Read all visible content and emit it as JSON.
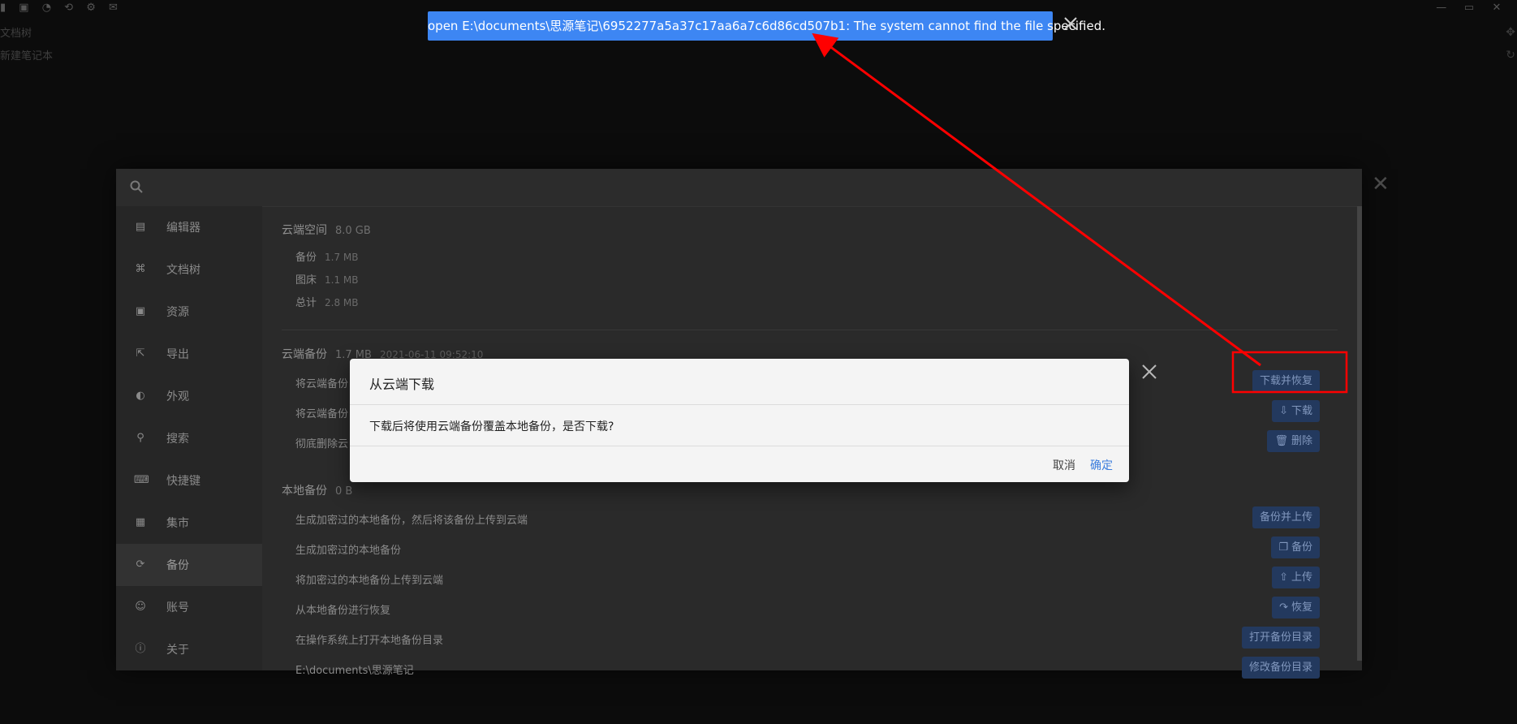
{
  "background": {
    "top_icons": "▮ ▣ ◔ ⟲ ⚙ ✉",
    "line_1": "文档树",
    "line_2": "新建笔记本",
    "window_buttons": [
      "—",
      "▭",
      "✕"
    ]
  },
  "settings": {
    "search_placeholder": "",
    "sidebar": [
      {
        "label": "编辑器",
        "icon": "keyboard-icon",
        "glyph": "▤"
      },
      {
        "label": "文档树",
        "icon": "tree-icon",
        "glyph": "⌘"
      },
      {
        "label": "资源",
        "icon": "image-icon",
        "glyph": "▣"
      },
      {
        "label": "导出",
        "icon": "export-icon",
        "glyph": "⇱"
      },
      {
        "label": "外观",
        "icon": "palette-icon",
        "glyph": "◐"
      },
      {
        "label": "搜索",
        "icon": "search-icon",
        "glyph": "⚲"
      },
      {
        "label": "快捷键",
        "icon": "keyboard-icon",
        "glyph": "⌨"
      },
      {
        "label": "集市",
        "icon": "store-icon",
        "glyph": "▦"
      },
      {
        "label": "备份",
        "icon": "sync-icon",
        "glyph": "⟳"
      },
      {
        "label": "账号",
        "icon": "user-icon",
        "glyph": "☺"
      },
      {
        "label": "关于",
        "icon": "info-icon",
        "glyph": "ⓘ"
      }
    ],
    "active_index": 8,
    "cloud_space": {
      "title": "云端空间",
      "total": "8.0 GB"
    },
    "usage": [
      {
        "label": "备份",
        "value": "1.7 MB"
      },
      {
        "label": "图床",
        "value": "1.1 MB"
      },
      {
        "label": "总计",
        "value": "2.8 MB"
      }
    ],
    "cloud_backup": {
      "title": "云端备份",
      "size": "1.7 MB",
      "time": "2021-06-11 09:52:10"
    },
    "cloud_rows": [
      {
        "label": "将云端备份",
        "button": "下载并恢复",
        "icon": ""
      },
      {
        "label": "将云端备份",
        "button": "下载",
        "icon": "⇩"
      },
      {
        "label": "彻底删除云",
        "button": "删除",
        "icon": "🗑"
      }
    ],
    "local_backup": {
      "title": "本地备份",
      "size": "0 B",
      "time": ""
    },
    "local_rows": [
      {
        "label": "生成加密过的本地备份，然后将该备份上传到云端",
        "button": "备份并上传",
        "icon": ""
      },
      {
        "label": "生成加密过的本地备份",
        "button": "备份",
        "icon": "❐"
      },
      {
        "label": "将加密过的本地备份上传到云端",
        "button": "上传",
        "icon": "⇧"
      },
      {
        "label": "从本地备份进行恢复",
        "button": "恢复",
        "icon": "↷"
      },
      {
        "label": "在操作系统上打开本地备份目录",
        "button": "打开备份目录",
        "icon": ""
      },
      {
        "label": "E:\\documents\\思源笔记",
        "button": "修改备份目录",
        "icon": ""
      }
    ]
  },
  "modal": {
    "title": "从云端下载",
    "message": "下载后将使用云端备份覆盖本地备份，是否下载?",
    "cancel": "取消",
    "confirm": "确定"
  },
  "toast": {
    "message": "open E:\\documents\\思源笔记\\6952277a5a37c17aa6a7c6d86cd507b1: The system cannot find the file specified."
  },
  "colors": {
    "toast_bg": "#3d86f3",
    "confirm_text": "#3b7ddd",
    "annotation_red": "#ff0000"
  }
}
